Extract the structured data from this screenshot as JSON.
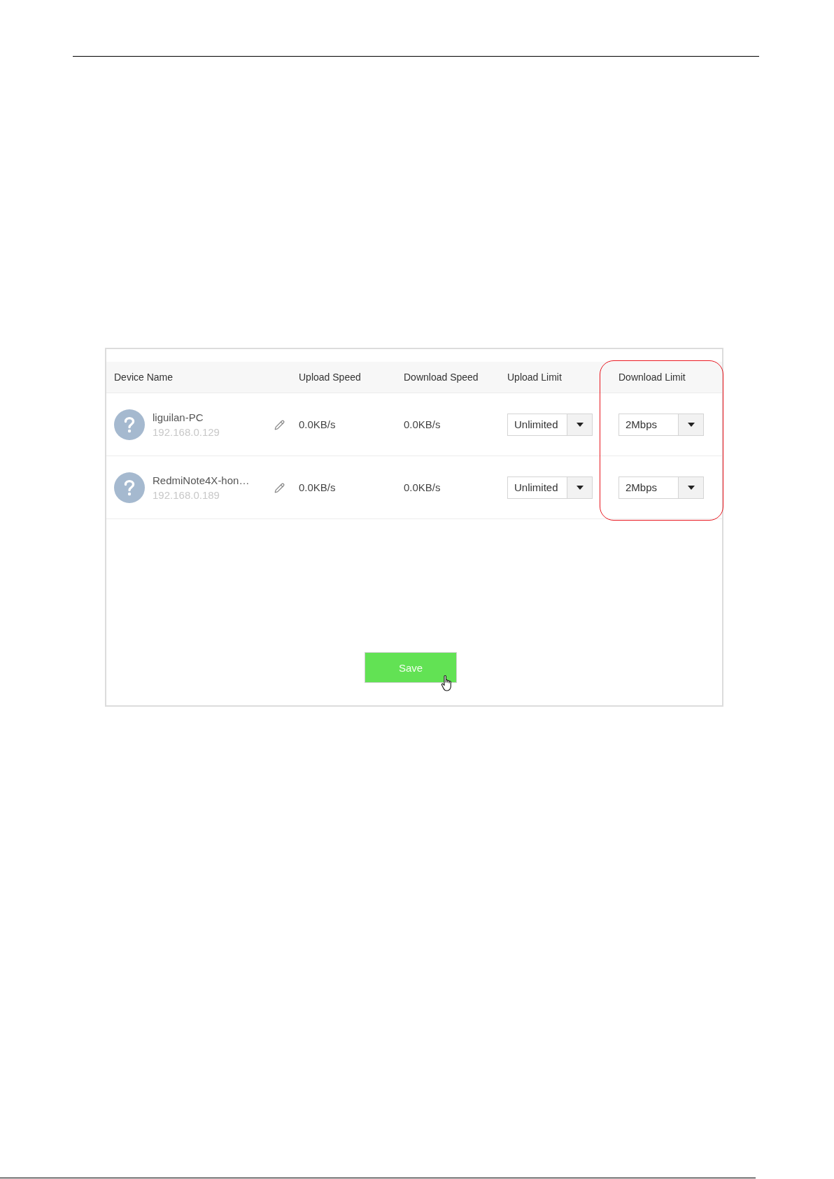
{
  "table": {
    "columns": [
      {
        "label": "Device Name",
        "highlighted": false
      },
      {
        "label": "Upload Speed",
        "highlighted": false
      },
      {
        "label": "Download Speed",
        "highlighted": false
      },
      {
        "label": "Upload Limit",
        "highlighted": false
      },
      {
        "label": "Download Limit",
        "highlighted": true
      }
    ],
    "rows": [
      {
        "device_name": "liguilan-PC",
        "ip": "192.168.0.129",
        "upload_speed": "0.0KB/s",
        "download_speed": "0.0KB/s",
        "upload_limit": "Unlimited",
        "download_limit": "2Mbps"
      },
      {
        "device_name": "RedmiNote4X-hon…",
        "ip": "192.168.0.189",
        "upload_speed": "0.0KB/s",
        "download_speed": "0.0KB/s",
        "upload_limit": "Unlimited",
        "download_limit": "2Mbps"
      }
    ]
  },
  "save_button": "Save"
}
